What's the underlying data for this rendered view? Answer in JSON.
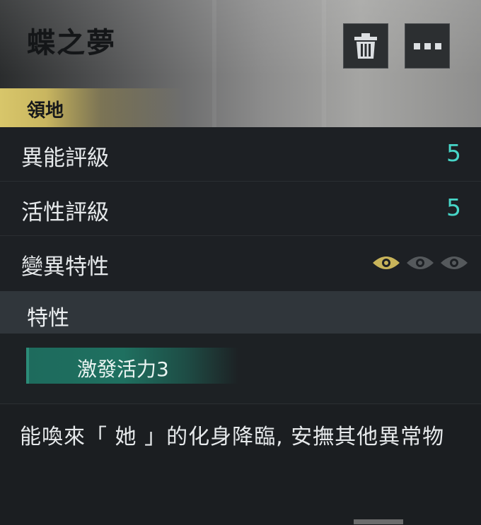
{
  "header": {
    "title": "蝶之夢",
    "delete_icon": "trash-icon",
    "more_icon": "more-dots-icon"
  },
  "tag": {
    "label": "領地",
    "color": "#d8c66a"
  },
  "stats": [
    {
      "label": "異能評級",
      "value": "5"
    },
    {
      "label": "活性評級",
      "value": "5"
    }
  ],
  "mutation": {
    "label": "變異特性",
    "level": 1,
    "max": 3,
    "active_color": "#c8b45a",
    "inactive_color": "#5a5e61"
  },
  "traits": {
    "header": "特性",
    "items": [
      {
        "label": "激發活力3"
      }
    ]
  },
  "description": "能喚來「 她 」的化身降臨, 安撫其他異常物",
  "colors": {
    "accent_teal": "#47d6c8"
  }
}
